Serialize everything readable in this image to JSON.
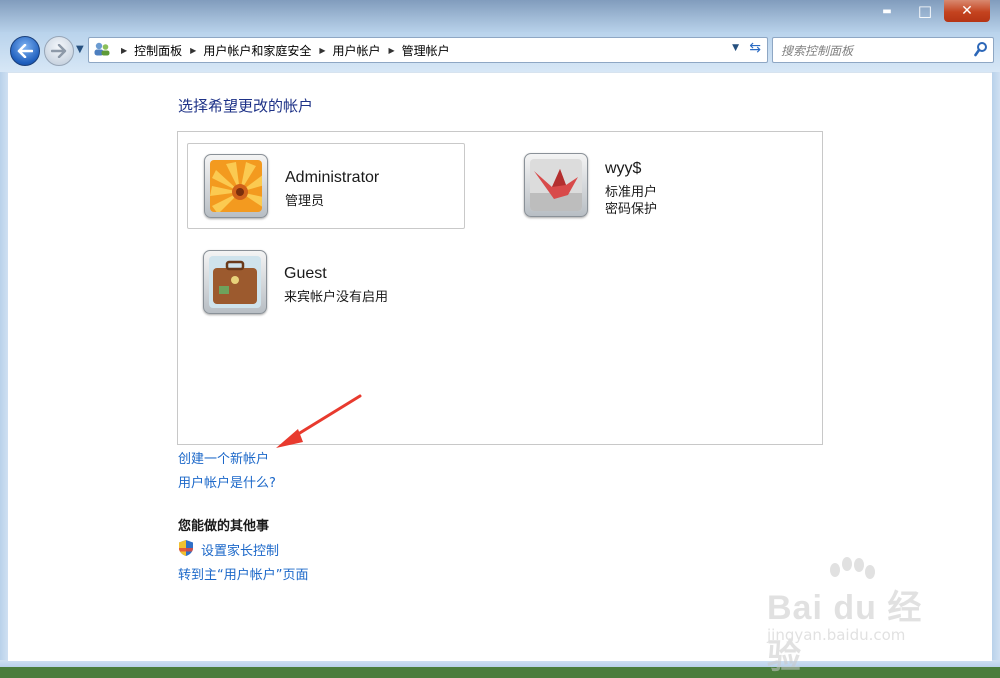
{
  "window": {
    "controls": {
      "minimize": "▬",
      "maximize": "□",
      "close": "✕"
    }
  },
  "nav": {
    "breadcrumbs": [
      "控制面板",
      "用户帐户和家庭安全",
      "用户帐户",
      "管理帐户"
    ],
    "search_placeholder": "搜索控制面板"
  },
  "content": {
    "heading": "选择希望更改的帐户",
    "accounts": [
      {
        "name": "Administrator",
        "line1": "管理员",
        "line2": "",
        "picture": "orange-flower-picture"
      },
      {
        "name": "wyy$",
        "line1": "标准用户",
        "line2": "密码保护",
        "picture": "paper-crane-picture"
      },
      {
        "name": "Guest",
        "line1": "来宾帐户没有启用",
        "line2": "",
        "picture": "suitcase-picture"
      }
    ],
    "links": {
      "create_account": "创建一个新帐户",
      "what_is_account": "用户帐户是什么?"
    },
    "other_tasks": {
      "heading": "您能做的其他事",
      "parental_controls": "设置家长控制",
      "goto_main": "转到主“用户帐户”页面"
    }
  },
  "watermark": {
    "text": "Bai  du 经验",
    "url": "jingyan.baidu.com"
  },
  "colors": {
    "link": "#1c68c9",
    "heading": "#1e3287",
    "annotation_arrow": "#e83a2e"
  }
}
